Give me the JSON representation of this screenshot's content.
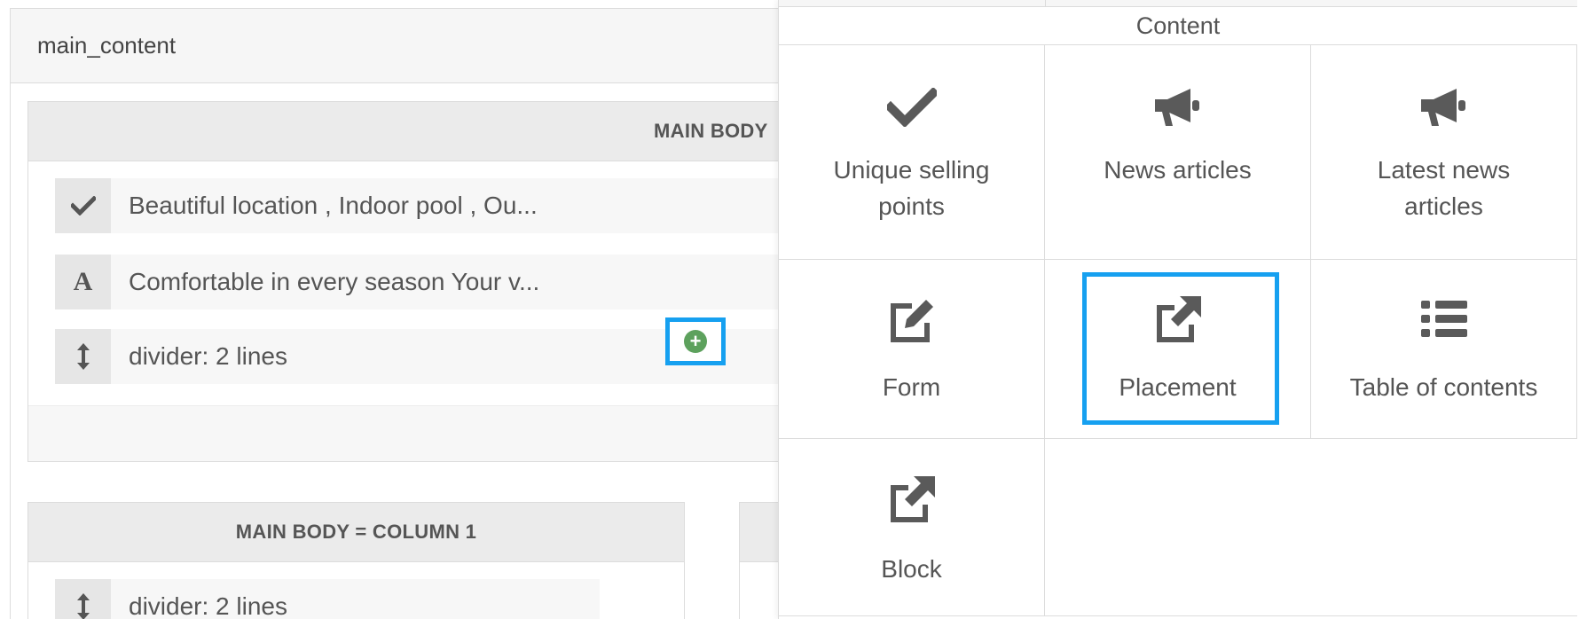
{
  "main": {
    "title": "main_content",
    "section1": {
      "heading": "MAIN BODY",
      "rows": [
        {
          "icon": "check-icon",
          "text": "Beautiful location , Indoor pool , Ou..."
        },
        {
          "icon": "font-icon",
          "text": "Comfortable in every season Your v..."
        },
        {
          "icon": "vertical-arrows-icon",
          "text": "divider: 2 lines"
        }
      ]
    },
    "section2": {
      "heading": "MAIN BODY = COLUMN 1",
      "rows": [
        {
          "icon": "vertical-arrows-icon",
          "text": "divider: 2 lines"
        }
      ]
    }
  },
  "content_panel": {
    "title": "Content",
    "items": [
      {
        "label_line1": "Unique selling",
        "label_line2": "points",
        "icon": "check-icon"
      },
      {
        "label_line1": "News articles",
        "label_line2": "",
        "icon": "megaphone-icon"
      },
      {
        "label_line1": "Latest news",
        "label_line2": "articles",
        "icon": "megaphone-icon"
      },
      {
        "label_line1": "Form",
        "label_line2": "",
        "icon": "edit-icon"
      },
      {
        "label_line1": "Placement",
        "label_line2": "",
        "icon": "external-link-icon"
      },
      {
        "label_line1": "Table of contents",
        "label_line2": "",
        "icon": "list-icon"
      },
      {
        "label_line1": "Block",
        "label_line2": "",
        "icon": "external-link-icon"
      }
    ]
  },
  "colors": {
    "highlight": "#16a0f0",
    "add_button": "#5da15d",
    "icon": "#555555"
  }
}
